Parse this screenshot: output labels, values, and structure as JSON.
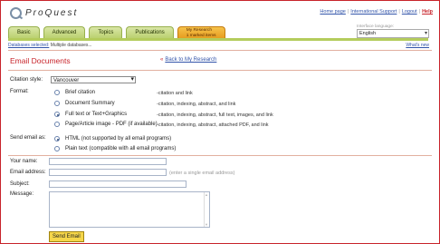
{
  "header": {
    "logo_text": "ProQuest",
    "links": [
      "Home page",
      "International Support",
      "Logout"
    ],
    "help": "Help",
    "interface_label": "Interface language:",
    "interface_value": "English",
    "whats_new": "What's new"
  },
  "tabs": [
    "Basic",
    "Advanced",
    "Topics",
    "Publications"
  ],
  "special_tab": {
    "line1": "My Research",
    "line2": "1 marked items"
  },
  "databases": {
    "label": "Databases selected:",
    "value": "Multiple databases..."
  },
  "page": {
    "title": "Email Documents",
    "back_prefix": "«",
    "back_label": "Back to My Research"
  },
  "form": {
    "citation_label": "Citation style:",
    "citation_value": "Vancouver",
    "format_label": "Format:",
    "formats": [
      {
        "label": "Brief citation",
        "desc": "-citation and link",
        "selected": false
      },
      {
        "label": "Document Summary",
        "desc": "-citation, indexing, abstract, and link",
        "selected": false
      },
      {
        "label": "Full text or Text+Graphics",
        "desc": "-citation, indexing, abstract, full text, images, and link",
        "selected": true
      },
      {
        "label": "Page/Article image - PDF (if available)",
        "desc": "-citation, indexing, abstract, attached PDF, and link",
        "selected": false
      }
    ],
    "send_as_label": "Send email as:",
    "send_as": [
      {
        "label": "HTML (not supported by all email programs)",
        "selected": true
      },
      {
        "label": "Plain text (compatible with all email programs)",
        "selected": false
      }
    ],
    "name_label": "Your name:",
    "email_label": "Email address:",
    "email_hint": "(enter a single email address)",
    "subject_label": "Subject:",
    "message_label": "Message:",
    "send_button": "Send Email"
  }
}
